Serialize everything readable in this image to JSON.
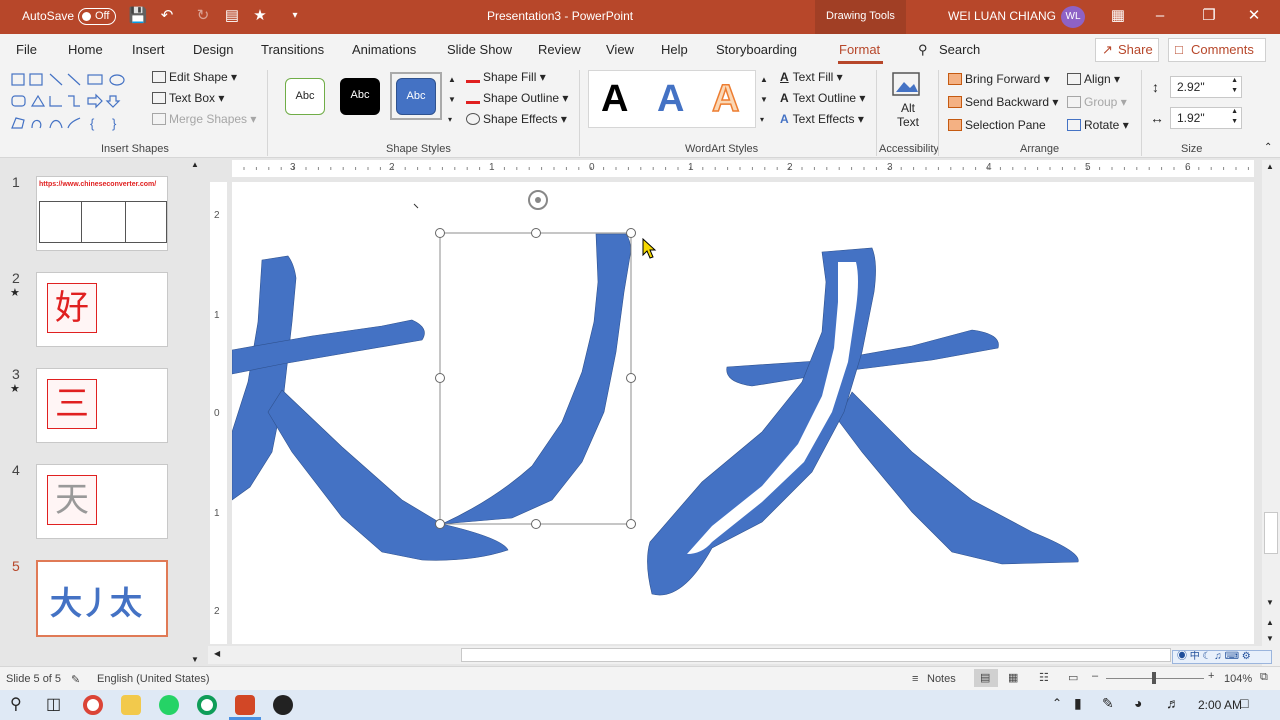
{
  "title_bar": {
    "autosave_label": "AutoSave",
    "autosave_state": "Off",
    "document_title": "Presentation3  -  PowerPoint",
    "context_tab": "Drawing Tools",
    "user_name": "WEI LUAN CHIANG",
    "user_initials": "WL"
  },
  "tabs": [
    "File",
    "Home",
    "Insert",
    "Design",
    "Transitions",
    "Animations",
    "Slide Show",
    "Review",
    "View",
    "Help",
    "Storyboarding",
    "Format"
  ],
  "active_tab": "Format",
  "search_label": "Search",
  "share_label": "Share",
  "comments_label": "Comments",
  "ribbon": {
    "insert_shapes": {
      "label": "Insert Shapes",
      "edit_shape": "Edit Shape",
      "text_box": "Text Box",
      "merge_shapes": "Merge Shapes"
    },
    "shape_styles": {
      "label": "Shape Styles",
      "presets": [
        "Abc",
        "Abc",
        "Abc"
      ],
      "shape_fill": "Shape Fill",
      "shape_outline": "Shape Outline",
      "shape_effects": "Shape Effects"
    },
    "wordart_styles": {
      "label": "WordArt Styles",
      "samples": [
        "A",
        "A",
        "A"
      ],
      "text_fill": "Text Fill",
      "text_outline": "Text Outline",
      "text_effects": "Text Effects"
    },
    "accessibility": {
      "label": "Accessibility",
      "alt_text_line1": "Alt",
      "alt_text_line2": "Text"
    },
    "arrange": {
      "label": "Arrange",
      "bring_forward": "Bring Forward",
      "send_backward": "Send Backward",
      "selection_pane": "Selection Pane",
      "align": "Align",
      "group": "Group",
      "rotate": "Rotate"
    },
    "size": {
      "label": "Size",
      "height": "2.92\"",
      "width": "1.92\""
    }
  },
  "slides": [
    {
      "number": "1",
      "url_text": "https://www.chineseconverter.com/",
      "starred": false
    },
    {
      "number": "2",
      "char": "好",
      "starred": true
    },
    {
      "number": "3",
      "char": "三",
      "starred": true
    },
    {
      "number": "4",
      "char": "天",
      "starred": false
    },
    {
      "number": "5",
      "chars": "大丿太",
      "starred": false,
      "active": true
    }
  ],
  "ruler_numbers": [
    "3",
    "2",
    "1",
    "0",
    "1",
    "2",
    "3",
    "4",
    "5",
    "6"
  ],
  "vruler_numbers": [
    "2",
    "1",
    "0",
    "1",
    "2"
  ],
  "status": {
    "slide_info": "Slide 5 of 5",
    "language": "English (United States)",
    "notes": "Notes",
    "zoom": "104%"
  },
  "taskbar": {
    "time": "2:00 AM"
  },
  "colors": {
    "accent": "#b7472a",
    "shape_blue": "#4472c4"
  }
}
